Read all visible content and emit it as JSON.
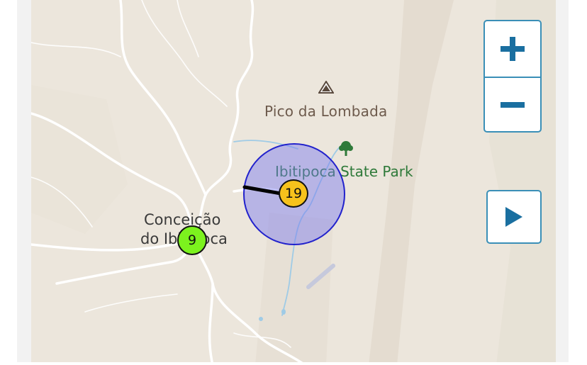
{
  "map": {
    "labels": {
      "peak": "Pico da Lombada",
      "park": "Ibitipoca State Park",
      "town_line1": "Conceição",
      "town_line2": "do Ibitipoca"
    },
    "clusters": [
      {
        "count": "19",
        "color": "#f7c21c"
      },
      {
        "count": "9",
        "color": "#7cf21e"
      }
    ],
    "radius_color": "#7878f0"
  },
  "controls": {
    "zoom_in_icon": "plus-icon",
    "zoom_out_icon": "minus-icon",
    "play_icon": "play-icon",
    "accent": "#1a6fa0"
  }
}
